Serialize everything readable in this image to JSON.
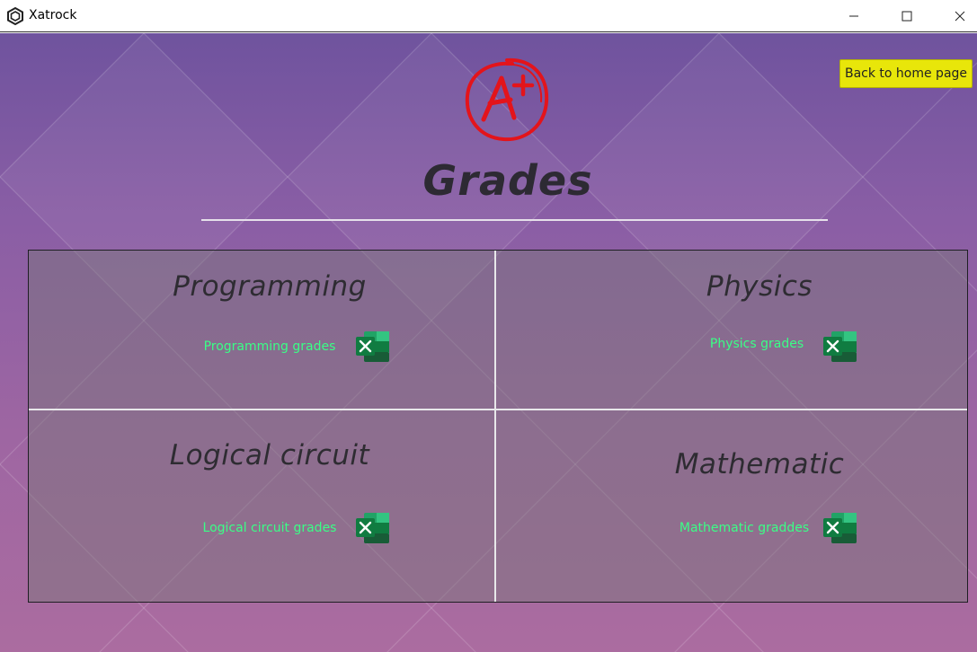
{
  "window": {
    "title": "Xatrock",
    "icons": {
      "app": "xatrock-hexagon-icon",
      "minimize": "minimize-icon",
      "maximize": "maximize-icon",
      "close": "close-icon"
    }
  },
  "header": {
    "home_button": "Back to home page",
    "logo_text": "A+",
    "title": "Grades"
  },
  "subjects": [
    {
      "title": "Programming",
      "link": "Programming grades",
      "icon": "excel-icon"
    },
    {
      "title": "Physics",
      "link": "Physics grades",
      "icon": "excel-icon"
    },
    {
      "title": "Logical circuit",
      "link": "Logical circuit grades",
      "icon": "excel-icon"
    },
    {
      "title": "Mathematic",
      "link": "Mathematic graddes",
      "icon": "excel-icon"
    }
  ],
  "colors": {
    "accent_button": "#e8e60a",
    "link": "#3aff86",
    "logo_red": "#e3141b",
    "excel_green": "#1f7a45"
  }
}
